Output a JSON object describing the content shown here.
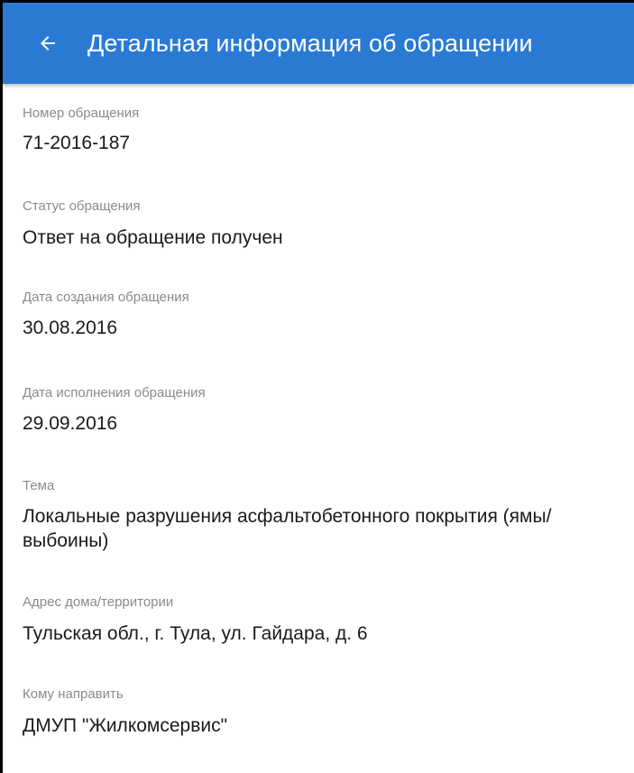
{
  "colors": {
    "appbar": "#2a7ad4",
    "label": "#8a8a8a",
    "value": "#1a1a1a"
  },
  "appbar": {
    "back_icon": "arrow-left-icon",
    "title": "Детальная информация об обращении"
  },
  "fields": {
    "number": {
      "label": "Номер обращения",
      "value": "71-2016-187"
    },
    "status": {
      "label": "Статус обращения",
      "value": "Ответ на обращение получен"
    },
    "created": {
      "label": "Дата создания обращения",
      "value": "30.08.2016"
    },
    "due": {
      "label": "Дата исполнения обращения",
      "value": "29.09.2016"
    },
    "topic": {
      "label": "Тема",
      "value": "Локальные разрушения асфальтобетонного покрытия (ямы/выбоины)"
    },
    "address": {
      "label": "Адрес дома/территории",
      "value": "Тульская обл., г. Тула, ул. Гайдара, д. 6"
    },
    "recipient": {
      "label": "Кому направить",
      "value": "ДМУП \"Жилкомсервис\""
    }
  }
}
